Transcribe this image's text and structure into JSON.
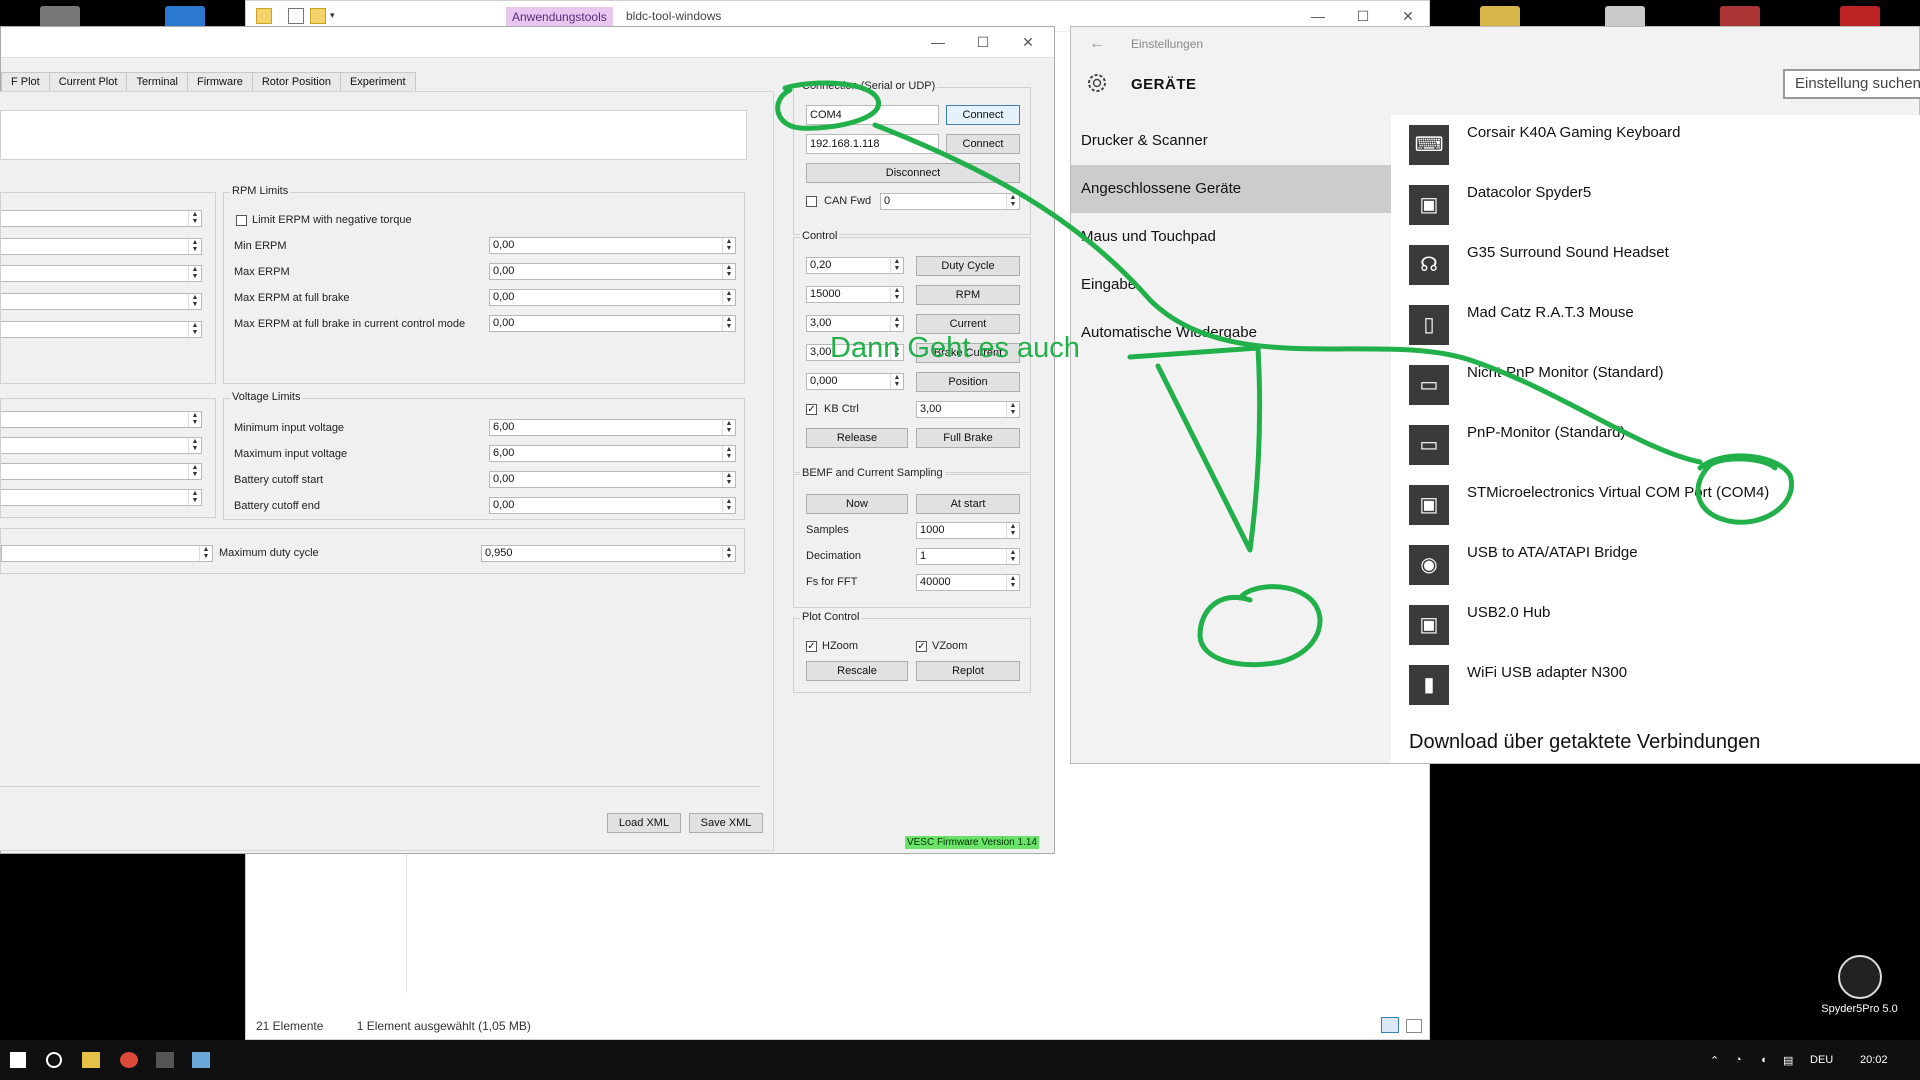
{
  "explorer": {
    "ribbon_tag": "Anwendungstools",
    "title": "bldc-tool-windows",
    "status_items": "21 Elemente",
    "status_selected": "1 Element ausgewählt (1,05 MB)"
  },
  "app": {
    "tabs": [
      "F Plot",
      "Current Plot",
      "Terminal",
      "Firmware",
      "Rotor Position",
      "Experiment"
    ],
    "rpm_limits": {
      "title": "RPM Limits",
      "limit_erpm_label": "Limit ERPM with negative torque",
      "min_erpm_label": "Min ERPM",
      "min_erpm_value": "0,00",
      "max_erpm_label": "Max ERPM",
      "max_erpm_value": "0,00",
      "max_erpm_brake_label": "Max ERPM at full brake",
      "max_erpm_brake_value": "0,00",
      "max_erpm_brake_cc_label": "Max ERPM at full brake in current control mode",
      "max_erpm_brake_cc_value": "0,00"
    },
    "voltage_limits": {
      "title": "Voltage Limits",
      "min_input_label": "Minimum input voltage",
      "min_input_value": "6,00",
      "max_input_label": "Maximum input voltage",
      "max_input_value": "6,00",
      "cutoff_start_label": "Battery cutoff start",
      "cutoff_start_value": "0,00",
      "cutoff_end_label": "Battery cutoff end",
      "cutoff_end_value": "0,00"
    },
    "max_duty_label": "Maximum duty cycle",
    "max_duty_value": "0,950",
    "load_xml": "Load XML",
    "save_xml": "Save XML",
    "connection": {
      "title": "Connection (Serial or UDP)",
      "serial_port": "COM4",
      "connect": "Connect",
      "ip": "192.168.1.118",
      "disconnect": "Disconnect",
      "can_fwd_label": "CAN Fwd",
      "can_fwd_value": "0"
    },
    "control": {
      "title": "Control",
      "duty_value": "0,20",
      "duty_button": "Duty Cycle",
      "rpm_value": "15000",
      "rpm_button": "RPM",
      "current_value": "3,00",
      "current_button": "Current",
      "brake_value": "3,00",
      "brake_button": "Brake Current",
      "position_value": "0,000",
      "position_button": "Position",
      "kb_ctrl_label": "KB Ctrl",
      "kb_ctrl_value": "3,00",
      "release": "Release",
      "full_brake": "Full Brake"
    },
    "bemf": {
      "title": "BEMF and Current Sampling",
      "now": "Now",
      "at_start": "At start",
      "samples_label": "Samples",
      "samples_value": "1000",
      "decimation_label": "Decimation",
      "decimation_value": "1",
      "fs_label": "Fs for FFT",
      "fs_value": "40000"
    },
    "plot_control": {
      "title": "Plot Control",
      "hzoom": "HZoom",
      "vzoom": "VZoom",
      "rescale": "Rescale",
      "replot": "Replot"
    },
    "firmware_version": "VESC Firmware Version 1.14"
  },
  "settings": {
    "window_title": "Einstellungen",
    "heading": "GERÄTE",
    "search_placeholder": "Einstellung suchen",
    "nav": [
      "Drucker & Scanner",
      "Angeschlossene Geräte",
      "Maus und Touchpad",
      "Eingabe",
      "Automatische Wiedergabe"
    ],
    "devices": [
      {
        "name": "Corsair K40A Gaming Keyboard",
        "icon": "keyboard-icon"
      },
      {
        "name": "Datacolor Spyder5",
        "icon": "device-icon"
      },
      {
        "name": "G35 Surround Sound Headset",
        "icon": "headset-icon"
      },
      {
        "name": "Mad Catz R.A.T.3 Mouse",
        "icon": "mouse-icon"
      },
      {
        "name": "Nicht-PnP Monitor (Standard)",
        "icon": "monitor-icon"
      },
      {
        "name": "PnP-Monitor (Standard)",
        "icon": "monitor-icon"
      },
      {
        "name": "STMicroelectronics Virtual COM Port (COM4)",
        "icon": "device-icon"
      },
      {
        "name": "USB to ATA/ATAPI Bridge",
        "icon": "disc-icon"
      },
      {
        "name": "USB2.0 Hub",
        "icon": "device-icon"
      },
      {
        "name": "WiFi USB adapter N300",
        "icon": "usb-stick-icon"
      }
    ],
    "footer_heading": "Download über getaktete Verbindungen"
  },
  "annotation": {
    "text": "Dann Geht es auch",
    "color": "#22b04b"
  },
  "desktop": {
    "spyder_label": "Spyder5Pro 5.0"
  },
  "taskbar": {
    "language": "DEU",
    "time": "20:02"
  }
}
